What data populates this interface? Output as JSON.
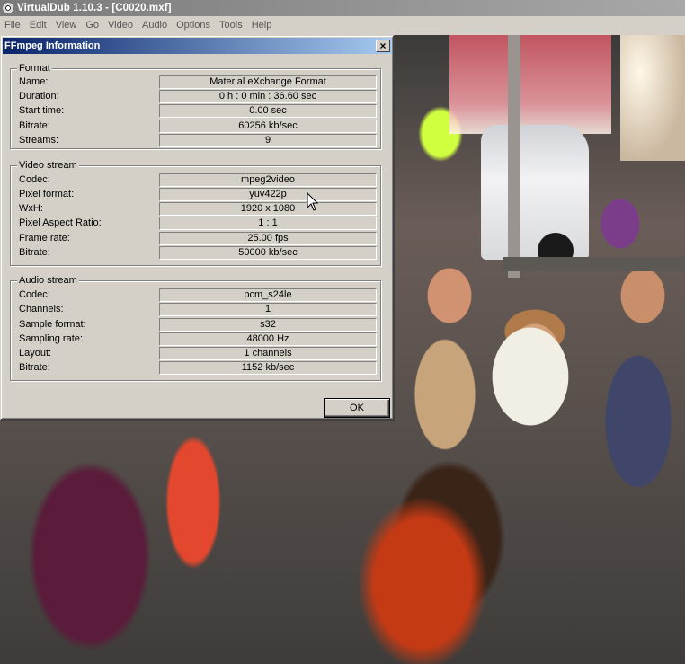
{
  "window": {
    "title": "VirtualDub 1.10.3 - [C0020.mxf]"
  },
  "menu": [
    "File",
    "Edit",
    "View",
    "Go",
    "Video",
    "Audio",
    "Options",
    "Tools",
    "Help"
  ],
  "dialog": {
    "title": "FFmpeg Information",
    "close_glyph": "×",
    "ok_label": "OK",
    "format": {
      "label": "Format",
      "rows": [
        {
          "label": "Name:",
          "value": "Material eXchange Format"
        },
        {
          "label": "Duration:",
          "value": "0 h : 0 min : 36.60 sec"
        },
        {
          "label": "Start time:",
          "value": "0.00 sec"
        },
        {
          "label": "Bitrate:",
          "value": "60256 kb/sec"
        },
        {
          "label": "Streams:",
          "value": "9"
        }
      ]
    },
    "video": {
      "label": "Video stream",
      "rows": [
        {
          "label": "Codec:",
          "value": "mpeg2video"
        },
        {
          "label": "Pixel format:",
          "value": "yuv422p"
        },
        {
          "label": "WxH:",
          "value": "1920 x 1080"
        },
        {
          "label": "Pixel Aspect Ratio:",
          "value": "1 : 1"
        },
        {
          "label": "Frame rate:",
          "value": "25.00 fps"
        },
        {
          "label": "Bitrate:",
          "value": "50000 kb/sec"
        }
      ]
    },
    "audio": {
      "label": "Audio stream",
      "rows": [
        {
          "label": "Codec:",
          "value": "pcm_s24le"
        },
        {
          "label": "Channels:",
          "value": "1"
        },
        {
          "label": "Sample format:",
          "value": "s32"
        },
        {
          "label": "Sampling rate:",
          "value": "48000 Hz"
        },
        {
          "label": "Layout:",
          "value": "1 channels"
        },
        {
          "label": "Bitrate:",
          "value": "1152 kb/sec"
        }
      ]
    }
  }
}
